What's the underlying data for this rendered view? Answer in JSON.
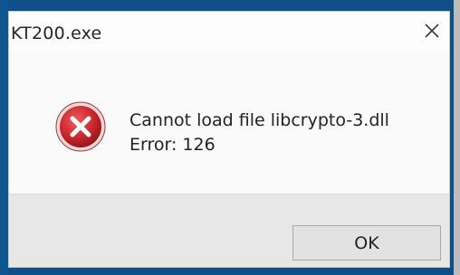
{
  "window": {
    "title": "KT200.exe"
  },
  "message": {
    "line1": "Cannot load file libcrypto-3.dll",
    "line2": "Error: 126"
  },
  "buttons": {
    "ok_label": "OK"
  },
  "icons": {
    "close": "close-icon",
    "error": "error-icon"
  },
  "colors": {
    "error_red": "#c8282d",
    "background_blue": "#0d4f86"
  }
}
